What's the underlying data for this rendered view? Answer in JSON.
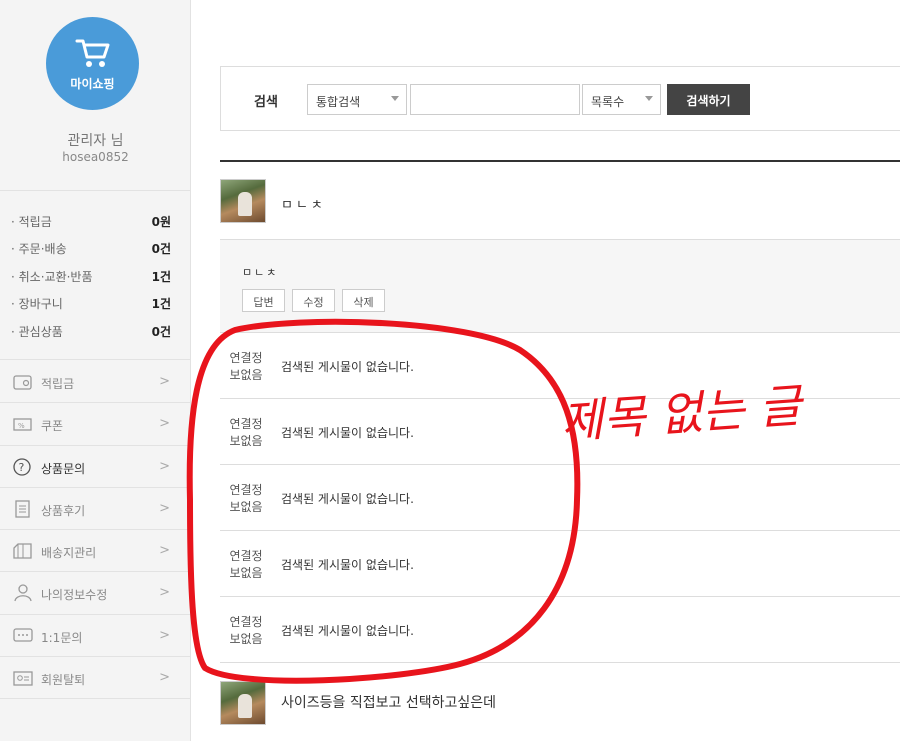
{
  "sidebar": {
    "cart_label": "마이쇼핑",
    "user_name": "관리자 님",
    "user_id": "hosea0852",
    "stats": [
      {
        "label": "· 적립금",
        "value": "0원"
      },
      {
        "label": "· 주문·배송",
        "value": "0건"
      },
      {
        "label": "· 취소·교환·반품",
        "value": "1건"
      },
      {
        "label": "· 장바구니",
        "value": "1건"
      },
      {
        "label": "· 관심상품",
        "value": "0건"
      }
    ],
    "menu": [
      {
        "label": "적립금",
        "icon": "wallet-icon"
      },
      {
        "label": "쿠폰",
        "icon": "coupon-icon"
      },
      {
        "label": "상품문의",
        "icon": "question-icon"
      },
      {
        "label": "상품후기",
        "icon": "clipboard-icon"
      },
      {
        "label": "배송지관리",
        "icon": "box-icon"
      },
      {
        "label": "나의정보수정",
        "icon": "user-icon"
      },
      {
        "label": "1:1문의",
        "icon": "chat-icon"
      },
      {
        "label": "회원탈퇴",
        "icon": "id-card-icon"
      }
    ],
    "chevron": ">"
  },
  "search": {
    "label": "검색",
    "type_select": "통합검색",
    "input_value": "",
    "count_select": "목록수",
    "button": "검색하기"
  },
  "posts": {
    "first_title": "ㅁㄴㅊ",
    "answer_text": "ㅁㄴㅊ",
    "buttons": {
      "reply": "답변",
      "edit": "수정",
      "delete": "삭제"
    },
    "empty_rows": [
      {
        "tag": "연결정보없음",
        "message": "검색된 게시물이 없습니다."
      },
      {
        "tag": "연결정보없음",
        "message": "검색된 게시물이 없습니다."
      },
      {
        "tag": "연결정보없음",
        "message": "검색된 게시물이 없습니다."
      },
      {
        "tag": "연결정보없음",
        "message": "검색된 게시물이 없습니다."
      },
      {
        "tag": "연결정보없음",
        "message": "검색된 게시물이 없습니다."
      }
    ],
    "last_title": "사이즈등을 직접보고 선택하고싶은데"
  },
  "annotation": {
    "handwritten_text": "제목 없는 글",
    "color": "#e8141c"
  },
  "colors": {
    "accent": "#4a9bd9",
    "button_dark": "#444444"
  }
}
